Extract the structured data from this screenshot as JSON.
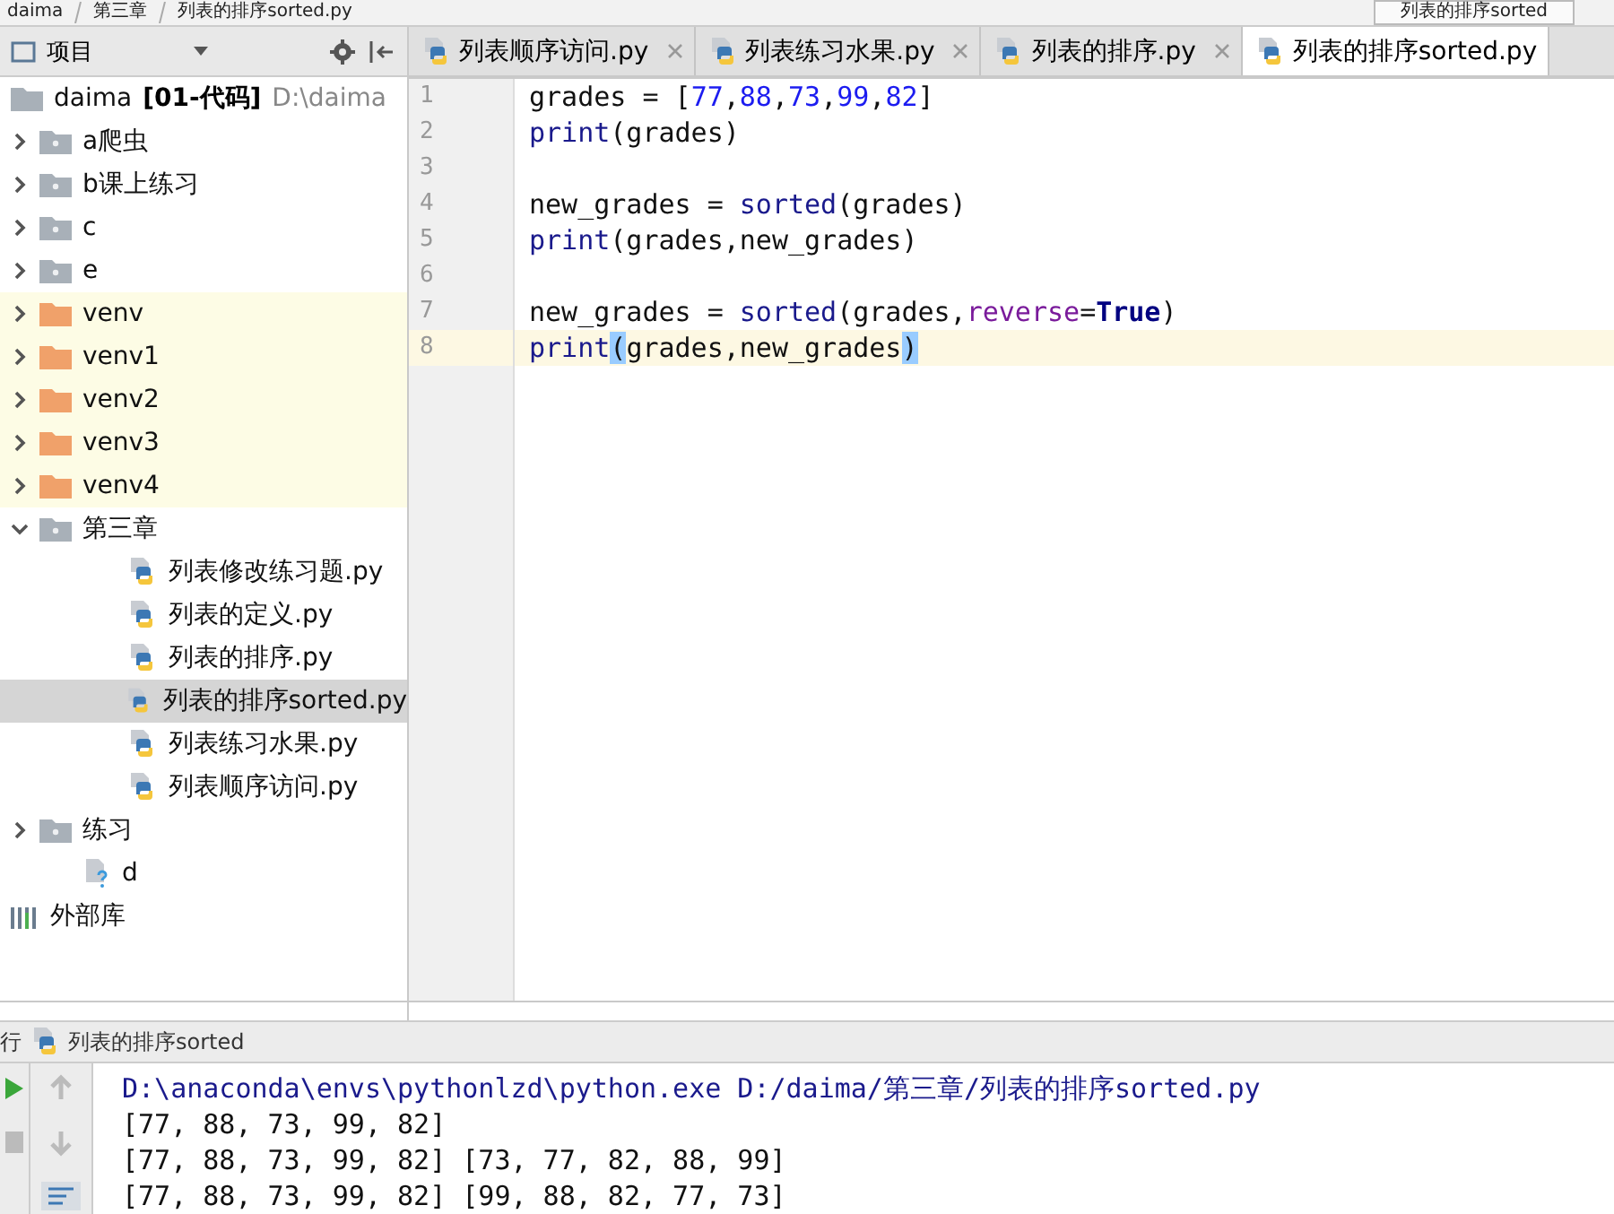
{
  "breadcrumb": [
    "daima",
    "第三章",
    "列表的排序sorted.py"
  ],
  "popup_label": "列表的排序sorted",
  "project_panel": {
    "title": "项目",
    "root": {
      "name": "daima",
      "module": "[01-代码]",
      "path": "D:\\daima",
      "children": [
        {
          "kind": "folder",
          "name": "a爬虫",
          "expanded": false,
          "excluded": false,
          "selected": false
        },
        {
          "kind": "folder",
          "name": "b课上练习",
          "expanded": false,
          "excluded": false,
          "selected": false
        },
        {
          "kind": "folder",
          "name": "c",
          "expanded": false,
          "excluded": false,
          "selected": false
        },
        {
          "kind": "folder",
          "name": "e",
          "expanded": false,
          "excluded": false,
          "selected": false
        },
        {
          "kind": "folder",
          "name": "venv",
          "expanded": false,
          "excluded": true,
          "selected": false
        },
        {
          "kind": "folder",
          "name": "venv1",
          "expanded": false,
          "excluded": true,
          "selected": false
        },
        {
          "kind": "folder",
          "name": "venv2",
          "expanded": false,
          "excluded": true,
          "selected": false
        },
        {
          "kind": "folder",
          "name": "venv3",
          "expanded": false,
          "excluded": true,
          "selected": false
        },
        {
          "kind": "folder",
          "name": "venv4",
          "expanded": false,
          "excluded": true,
          "selected": false
        },
        {
          "kind": "folder",
          "name": "第三章",
          "expanded": true,
          "excluded": false,
          "selected": false,
          "children": [
            {
              "kind": "python",
              "name": "列表修改练习题.py",
              "selected": false
            },
            {
              "kind": "python",
              "name": "列表的定义.py",
              "selected": false
            },
            {
              "kind": "python",
              "name": "列表的排序.py",
              "selected": false
            },
            {
              "kind": "python",
              "name": "列表的排序sorted.py",
              "selected": true
            },
            {
              "kind": "python",
              "name": "列表练习水果.py",
              "selected": false
            },
            {
              "kind": "python",
              "name": "列表顺序访问.py",
              "selected": false
            }
          ]
        },
        {
          "kind": "folder",
          "name": "练习",
          "expanded": false,
          "excluded": false,
          "selected": false
        },
        {
          "kind": "unknown",
          "name": "d",
          "selected": false
        }
      ]
    },
    "libraries": "外部库"
  },
  "tabs": [
    {
      "label": "列表顺序访问.py",
      "selected": false,
      "closable": true
    },
    {
      "label": "列表练习水果.py",
      "selected": false,
      "closable": true
    },
    {
      "label": "列表的排序.py",
      "selected": false,
      "closable": true
    },
    {
      "label": "列表的排序sorted.py",
      "selected": true,
      "closable": false
    }
  ],
  "code_lines": [
    {
      "number": "1",
      "current": false,
      "tokens": [
        {
          "kind": "plain",
          "text": "grades = ["
        },
        {
          "kind": "number",
          "text": "77"
        },
        {
          "kind": "plain",
          "text": ","
        },
        {
          "kind": "number",
          "text": "88"
        },
        {
          "kind": "plain",
          "text": ","
        },
        {
          "kind": "number",
          "text": "73"
        },
        {
          "kind": "plain",
          "text": ","
        },
        {
          "kind": "number",
          "text": "99"
        },
        {
          "kind": "plain",
          "text": ","
        },
        {
          "kind": "number",
          "text": "82"
        },
        {
          "kind": "plain",
          "text": "]"
        }
      ]
    },
    {
      "number": "2",
      "current": false,
      "tokens": [
        {
          "kind": "builtin",
          "text": "print"
        },
        {
          "kind": "plain",
          "text": "(grades)"
        }
      ]
    },
    {
      "number": "3",
      "current": false
    },
    {
      "number": "4",
      "current": false,
      "tokens": [
        {
          "kind": "plain",
          "text": "new_grades = "
        },
        {
          "kind": "builtin",
          "text": "sorted"
        },
        {
          "kind": "plain",
          "text": "(grades)"
        }
      ]
    },
    {
      "number": "5",
      "current": false,
      "tokens": [
        {
          "kind": "builtin",
          "text": "print"
        },
        {
          "kind": "plain",
          "text": "(grades,new_grades)"
        }
      ]
    },
    {
      "number": "6",
      "current": false
    },
    {
      "number": "7",
      "current": false,
      "tokens": [
        {
          "kind": "plain",
          "text": "new_grades = "
        },
        {
          "kind": "builtin",
          "text": "sorted"
        },
        {
          "kind": "plain",
          "text": "(grades,"
        },
        {
          "kind": "kwarg",
          "text": "reverse"
        },
        {
          "kind": "plain",
          "text": "="
        },
        {
          "kind": "keyword",
          "text": "True"
        },
        {
          "kind": "plain",
          "text": ")"
        }
      ]
    },
    {
      "number": "8",
      "current": true,
      "tokens": [
        {
          "kind": "builtin",
          "text": "print"
        },
        {
          "kind": "match",
          "text": "("
        },
        {
          "kind": "plain",
          "text": "grades,new_grades"
        },
        {
          "kind": "match",
          "text": ")"
        }
      ]
    }
  ],
  "run_panel": {
    "label": "行",
    "config": "列表的排序sorted",
    "output": [
      {
        "kind": "command",
        "text": "D:\\anaconda\\envs\\pythonlzd\\python.exe D:/daima/第三章/列表的排序sorted.py"
      },
      {
        "kind": "stdout",
        "text": "[77, 88, 73, 99, 82]"
      },
      {
        "kind": "stdout",
        "text": "[77, 88, 73, 99, 82] [73, 77, 82, 88, 99]"
      },
      {
        "kind": "stdout",
        "text": "[77, 88, 73, 99, 82] [99, 88, 82, 77, 73]"
      }
    ]
  }
}
